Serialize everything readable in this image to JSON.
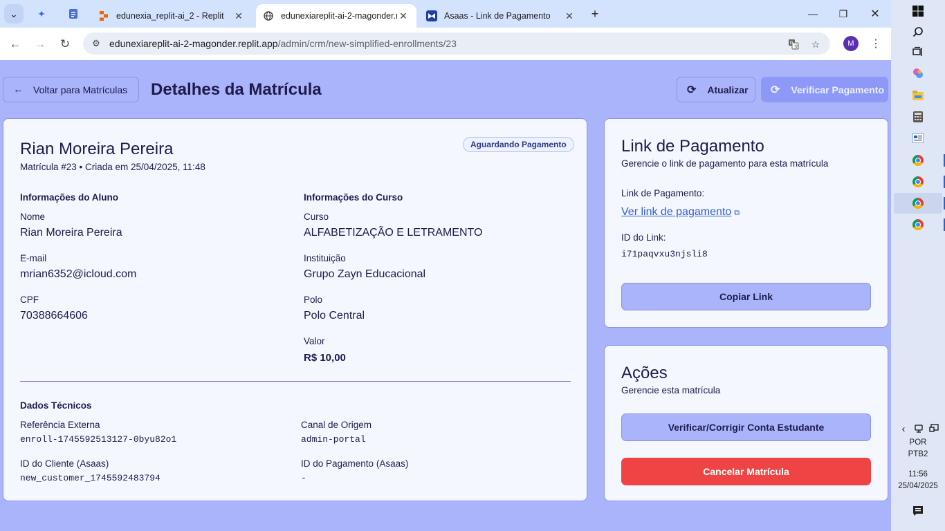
{
  "browser": {
    "tabs": [
      {
        "title": "edunexia_replit-ai_2 - Replit",
        "icon": "replit-icon"
      },
      {
        "title": "edunexiareplit-ai-2-magonder.r",
        "icon": "globe-icon"
      },
      {
        "title": "Asaas - Link de Pagamento",
        "icon": "asaas-icon"
      }
    ],
    "url_host": "edunexiareplit-ai-2-magonder.replit.app",
    "url_path": "/admin/crm/new-simplified-enrollments/23",
    "profile_initial": "M"
  },
  "page": {
    "back_label": "Voltar para Matrículas",
    "title": "Detalhes da Matrícula",
    "refresh_label": "Atualizar",
    "verify_label": "Verificar Pagamento"
  },
  "enrollment": {
    "name": "Rian Moreira Pereira",
    "subtitle": "Matrícula #23 • Criada em 25/04/2025, 11:48",
    "status": "Aguardando Pagamento",
    "student_section": "Informações do Aluno",
    "course_section": "Informações do Curso",
    "fields": {
      "nome_label": "Nome",
      "nome": "Rian Moreira Pereira",
      "email_label": "E-mail",
      "email": "mrian6352@icloud.com",
      "cpf_label": "CPF",
      "cpf": "70388664606",
      "curso_label": "Curso",
      "curso": "ALFABETIZAÇÃO E LETRAMENTO",
      "inst_label": "Instituição",
      "inst": "Grupo Zayn Educacional",
      "polo_label": "Polo",
      "polo": "Polo Central",
      "valor_label": "Valor",
      "valor": "R$ 10,00"
    },
    "tech_section": "Dados Técnicos",
    "tech": {
      "ref_label": "Referência Externa",
      "ref": "enroll-1745592513127-0byu82o1",
      "canal_label": "Canal de Origem",
      "canal": "admin-portal",
      "cliente_label": "ID do Cliente (Asaas)",
      "cliente": "new_customer_1745592483794",
      "pagamento_label": "ID do Pagamento (Asaas)",
      "pagamento": "-"
    }
  },
  "payment_card": {
    "title": "Link de Pagamento",
    "desc": "Gerencie o link de pagamento para esta matrícula",
    "link_label": "Link de Pagamento:",
    "link_text": "Ver link de pagamento",
    "id_label": "ID do Link:",
    "id_value": "i71paqvxu3njsli8",
    "copy_label": "Copiar Link"
  },
  "actions_card": {
    "title": "Ações",
    "desc": "Gerencie esta matrícula",
    "fix_label": "Verificar/Corrigir Conta Estudante",
    "cancel_label": "Cancelar Matrícula"
  },
  "taskbar": {
    "lang1": "POR",
    "lang2": "PTB2",
    "time": "11:56",
    "date": "25/04/2025"
  }
}
